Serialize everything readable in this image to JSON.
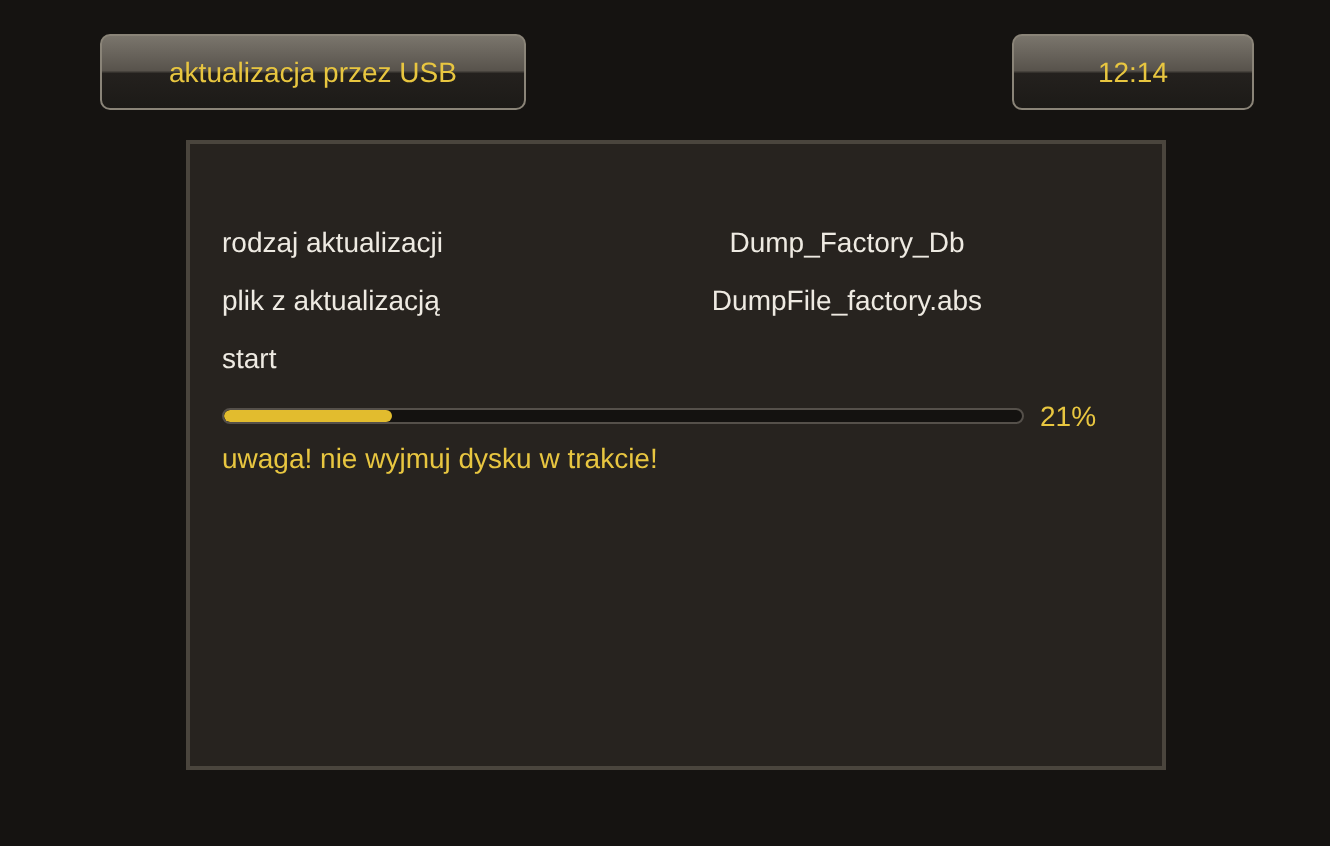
{
  "header": {
    "title": "aktualizacja przez USB",
    "clock": "12:14"
  },
  "settings": [
    {
      "label": "rodzaj aktualizacji",
      "value": "Dump_Factory_Db"
    },
    {
      "label": "plik z aktualizacją",
      "value": "DumpFile_factory.abs"
    },
    {
      "label": "start"
    }
  ],
  "progress": {
    "level": 0.21,
    "reading": "21%"
  },
  "warning": "uwaga! nie wyjmuj dysku w trakcie!"
}
